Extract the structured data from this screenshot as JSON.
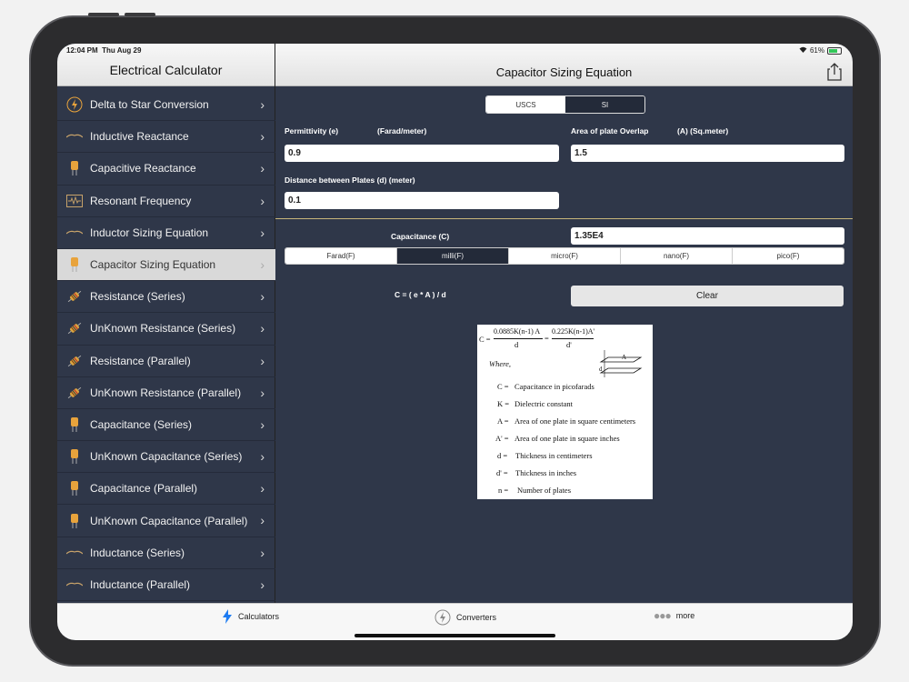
{
  "status": {
    "time": "12:04 PM",
    "date": "Thu Aug 29",
    "battery": "61%"
  },
  "sidebar": {
    "title": "Electrical Calculator",
    "items": [
      {
        "label": "Delta to Star Conversion",
        "icon": "lightning-circle-icon"
      },
      {
        "label": "Inductive Reactance",
        "icon": "inductor-icon"
      },
      {
        "label": "Capacitive Reactance",
        "icon": "capacitor-icon"
      },
      {
        "label": "Resonant Frequency",
        "icon": "oscilloscope-icon"
      },
      {
        "label": "Inductor Sizing Equation",
        "icon": "inductor-icon"
      },
      {
        "label": "Capacitor Sizing Equation",
        "icon": "capacitor-icon",
        "selected": true
      },
      {
        "label": "Resistance (Series)",
        "icon": "resistor-icon"
      },
      {
        "label": "UnKnown Resistance (Series)",
        "icon": "resistor-icon"
      },
      {
        "label": "Resistance (Parallel)",
        "icon": "resistor-icon"
      },
      {
        "label": "UnKnown Resistance (Parallel)",
        "icon": "resistor-icon"
      },
      {
        "label": "Capacitance (Series)",
        "icon": "capacitor-icon"
      },
      {
        "label": "UnKnown Capacitance (Series)",
        "icon": "capacitor-icon"
      },
      {
        "label": "Capacitance (Parallel)",
        "icon": "capacitor-icon"
      },
      {
        "label": "UnKnown Capacitance (Parallel)",
        "icon": "capacitor-icon"
      },
      {
        "label": "Inductance (Series)",
        "icon": "inductor-icon"
      },
      {
        "label": "Inductance (Parallel)",
        "icon": "inductor-icon"
      }
    ]
  },
  "main": {
    "title": "Capacitor Sizing Equation",
    "system_tabs": [
      {
        "label": "USCS",
        "selected": true
      },
      {
        "label": "SI",
        "selected": false
      }
    ],
    "permittivity": {
      "label": "Permittivity (e)",
      "unit": "(Farad/meter)",
      "value": "0.9"
    },
    "area": {
      "label": "Area of plate Overlap",
      "unit": "(A) (Sq.meter)",
      "value": "1.5"
    },
    "distance": {
      "label": "Distance between Plates (d) (meter)",
      "value": "0.1"
    },
    "capacitance": {
      "label": "Capacitance (C)",
      "value": "1.35E4"
    },
    "unit_tabs": [
      {
        "label": "Farad(F)",
        "selected": true
      },
      {
        "label": "milli(F)",
        "selected": false
      },
      {
        "label": "micro(F)",
        "selected": true
      },
      {
        "label": "nano(F)",
        "selected": true
      },
      {
        "label": "pico(F)",
        "selected": true
      }
    ],
    "formula": "C = ( e * A ) / d",
    "clear_label": "Clear",
    "image": {
      "c": "C =",
      "num1": "0.0885K(n-1) A",
      "den1": "d",
      "eq": "=",
      "num2": "0.225K(n-1)A'",
      "den2": "d'",
      "where": "Where,",
      "diag_a": "A",
      "diag_d": "d",
      "defs": [
        {
          "sym": "C =",
          "text": "Capacitance in picofarads"
        },
        {
          "sym": "K =",
          "text": "Dielectric constant"
        },
        {
          "sym": "A =",
          "text": "Area of one plate in square centimeters"
        },
        {
          "sym": "A' =",
          "text": "Area of one plate in square inches"
        },
        {
          "sym": "d =",
          "text": "Thickness in centimeters"
        },
        {
          "sym": "d' =",
          "text": "Thickness in inches"
        },
        {
          "sym": "n =",
          "text": "Number of plates"
        }
      ]
    }
  },
  "tabbar": {
    "calculators": "Calculators",
    "converters": "Converters",
    "more": "more"
  },
  "colors": {
    "panel": "#2f3749",
    "accent_icon": "#e8a33c",
    "divider": "#c8b57a"
  }
}
